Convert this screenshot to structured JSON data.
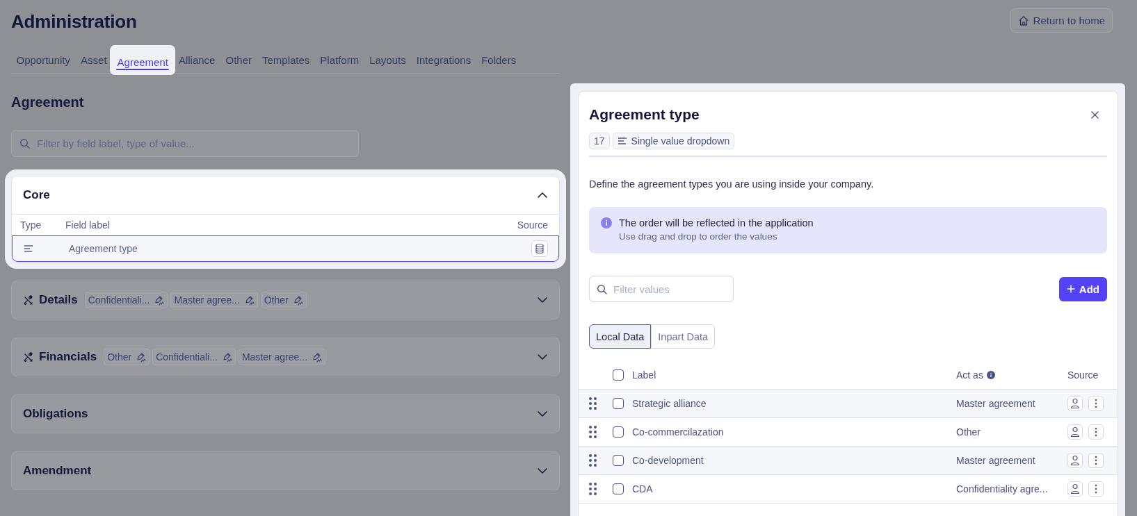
{
  "header": {
    "title": "Administration",
    "return_button": "Return to home"
  },
  "tabs": [
    {
      "label": "Opportunity",
      "selected": false
    },
    {
      "label": "Asset",
      "selected": false
    },
    {
      "label": "Agreement",
      "selected": true
    },
    {
      "label": "Alliance",
      "selected": false
    },
    {
      "label": "Other",
      "selected": false
    },
    {
      "label": "Templates",
      "selected": false
    },
    {
      "label": "Platform",
      "selected": false
    },
    {
      "label": "Layouts",
      "selected": false
    },
    {
      "label": "Integrations",
      "selected": false
    },
    {
      "label": "Folders",
      "selected": false
    }
  ],
  "heading": "Agreement",
  "filter": {
    "placeholder": "Filter by field label, type of value..."
  },
  "sections": [
    {
      "title": "Core",
      "kind": "plain",
      "expanded": true,
      "spotlight": true,
      "columns": [
        "Type",
        "Field label",
        "Source"
      ],
      "rows": [
        {
          "label": "Agreement type",
          "selected": true
        }
      ]
    },
    {
      "title": "Details",
      "kind": "tagged",
      "expanded": false,
      "spotlight": false,
      "tags": [
        "Confidentiali...",
        "Master agree...",
        "Other"
      ]
    },
    {
      "title": "Financials",
      "kind": "tagged",
      "expanded": false,
      "spotlight": false,
      "tags": [
        "Other",
        "Confidentiali...",
        "Master agree..."
      ]
    },
    {
      "title": "Obligations",
      "kind": "plain",
      "expanded": false,
      "spotlight": false
    },
    {
      "title": "Amendment",
      "kind": "plain",
      "expanded": false,
      "spotlight": false
    }
  ],
  "panel": {
    "title": "Agreement type",
    "count": "17",
    "value_type": "Single value dropdown",
    "description": "Define the agreement types you are using inside your company.",
    "info": {
      "title": "The order will be reflected in the application",
      "subtitle": "Use drag and drop to order the values"
    },
    "filter": {
      "placeholder": "Filter values"
    },
    "add_button": "Add",
    "data_tabs": [
      {
        "label": "Local Data",
        "selected": true
      },
      {
        "label": "Inpart Data",
        "selected": false
      }
    ],
    "table": {
      "all_checked": false,
      "columns": [
        "Label",
        "Act as",
        "Source"
      ],
      "rows": [
        {
          "label": "Strategic alliance",
          "act_as": "Master agreement",
          "checked": false
        },
        {
          "label": "Co-commercilazation",
          "act_as": "Other",
          "checked": false
        },
        {
          "label": "Co-development",
          "act_as": "Master agreement",
          "checked": false
        },
        {
          "label": "CDA",
          "act_as": "Confidentiality agre...",
          "checked": false
        }
      ]
    }
  }
}
